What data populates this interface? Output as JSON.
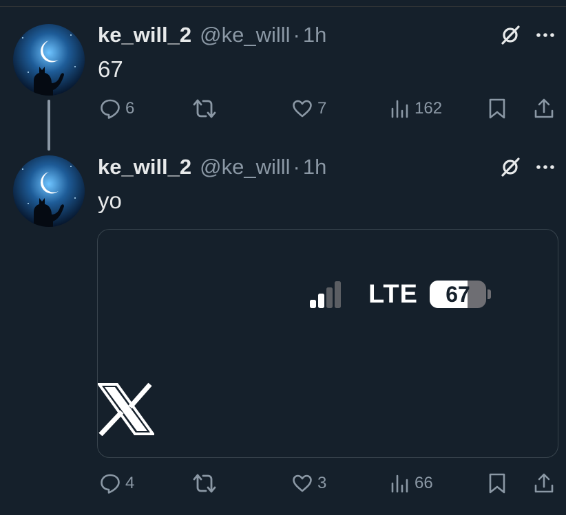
{
  "tweets": [
    {
      "display_name": "ke_will_2",
      "handle": "@ke_willl",
      "separator": "·",
      "time": "1h",
      "text": "67",
      "actions": {
        "replies": "6",
        "reposts": "",
        "likes": "7",
        "views": "162"
      }
    },
    {
      "display_name": "ke_will_2",
      "handle": "@ke_willl",
      "separator": "·",
      "time": "1h",
      "text": "yo",
      "media": {
        "network": "LTE",
        "signal_bars_active": 2,
        "signal_bars_total": 4,
        "battery_level": "67",
        "battery_fraction": 0.67,
        "logo": "x-logo"
      },
      "actions": {
        "replies": "4",
        "reposts": "",
        "likes": "3",
        "views": "66"
      }
    }
  ],
  "icons": {
    "grok": "grok-icon",
    "more": "more-icon",
    "reply": "reply-icon",
    "repost": "repost-icon",
    "like": "like-icon",
    "views": "views-icon",
    "bookmark": "bookmark-icon",
    "share": "share-icon"
  },
  "colors": {
    "background": "#15202b",
    "text_primary": "#e7e9ea",
    "text_secondary": "#8b98a5",
    "card_border": "#38444d",
    "thread_line": "#8b98a5"
  }
}
